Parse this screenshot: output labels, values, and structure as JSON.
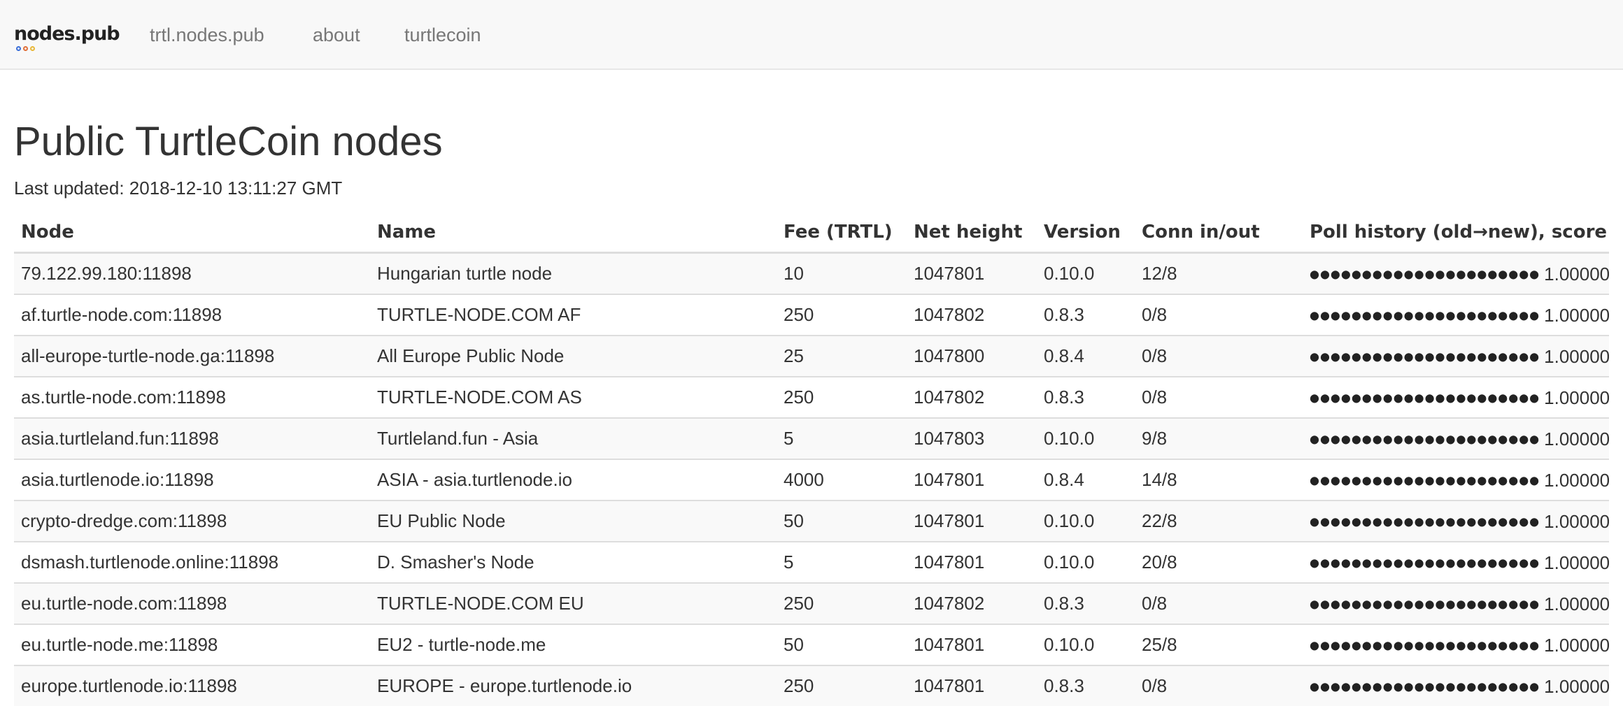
{
  "nav": {
    "brand": "nodes.pub",
    "brand_dot_colors": [
      "#3b6fd8",
      "#e0703a",
      "#e8b83a"
    ],
    "links": [
      "trtl.nodes.pub",
      "about",
      "turtlecoin"
    ]
  },
  "page": {
    "title": "Public TurtleCoin nodes",
    "last_updated": "Last updated: 2018-12-10 13:11:27 GMT"
  },
  "table": {
    "headers": [
      "Node",
      "Name",
      "Fee (TRTL)",
      "Net height",
      "Version",
      "Conn in/out",
      "Poll history (old→new), score"
    ],
    "rows": [
      {
        "node": "79.122.99.180:11898",
        "name": "Hungarian turtle node",
        "fee": "10",
        "height": "1047801",
        "version": "0.10.0",
        "conn": "12/8",
        "history": "●●●●●●●●●●●●●●●●●●●●●●",
        "score": "1.00000"
      },
      {
        "node": "af.turtle-node.com:11898",
        "name": "TURTLE-NODE.COM AF",
        "fee": "250",
        "height": "1047802",
        "version": "0.8.3",
        "conn": "0/8",
        "history": "●●●●●●●●●●●●●●●●●●●●●●",
        "score": "1.00000"
      },
      {
        "node": "all-europe-turtle-node.ga:11898",
        "name": "All Europe Public Node",
        "fee": "25",
        "height": "1047800",
        "version": "0.8.4",
        "conn": "0/8",
        "history": "●●●●●●●●●●●●●●●●●●●●●●",
        "score": "1.00000"
      },
      {
        "node": "as.turtle-node.com:11898",
        "name": "TURTLE-NODE.COM AS",
        "fee": "250",
        "height": "1047802",
        "version": "0.8.3",
        "conn": "0/8",
        "history": "●●●●●●●●●●●●●●●●●●●●●●",
        "score": "1.00000"
      },
      {
        "node": "asia.turtleland.fun:11898",
        "name": "Turtleland.fun - Asia",
        "fee": "5",
        "height": "1047803",
        "version": "0.10.0",
        "conn": "9/8",
        "history": "●●●●●●●●●●●●●●●●●●●●●●",
        "score": "1.00000"
      },
      {
        "node": "asia.turtlenode.io:11898",
        "name": "ASIA - asia.turtlenode.io",
        "fee": "4000",
        "height": "1047801",
        "version": "0.8.4",
        "conn": "14/8",
        "history": "●●●●●●●●●●●●●●●●●●●●●●",
        "score": "1.00000"
      },
      {
        "node": "crypto-dredge.com:11898",
        "name": "EU Public Node",
        "fee": "50",
        "height": "1047801",
        "version": "0.10.0",
        "conn": "22/8",
        "history": "●●●●●●●●●●●●●●●●●●●●●●",
        "score": "1.00000"
      },
      {
        "node": "dsmash.turtlenode.online:11898",
        "name": "D. Smasher's Node",
        "fee": "5",
        "height": "1047801",
        "version": "0.10.0",
        "conn": "20/8",
        "history": "●●●●●●●●●●●●●●●●●●●●●●",
        "score": "1.00000"
      },
      {
        "node": "eu.turtle-node.com:11898",
        "name": "TURTLE-NODE.COM EU",
        "fee": "250",
        "height": "1047802",
        "version": "0.8.3",
        "conn": "0/8",
        "history": "●●●●●●●●●●●●●●●●●●●●●●",
        "score": "1.00000"
      },
      {
        "node": "eu.turtle-node.me:11898",
        "name": "EU2 - turtle-node.me",
        "fee": "50",
        "height": "1047801",
        "version": "0.10.0",
        "conn": "25/8",
        "history": "●●●●●●●●●●●●●●●●●●●●●●",
        "score": "1.00000"
      },
      {
        "node": "europe.turtlenode.io:11898",
        "name": "EUROPE - europe.turtlenode.io",
        "fee": "250",
        "height": "1047801",
        "version": "0.8.3",
        "conn": "0/8",
        "history": "●●●●●●●●●●●●●●●●●●●●●●",
        "score": "1.00000"
      }
    ]
  }
}
